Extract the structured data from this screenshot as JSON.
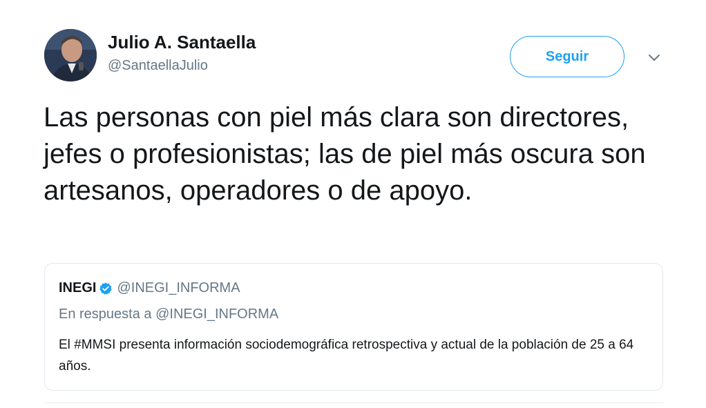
{
  "author": {
    "display_name": "Julio A. Santaella",
    "handle": "@SantaellaJulio",
    "avatar": "avatar-photo"
  },
  "actions": {
    "follow_label": "Seguir",
    "menu_icon": "chevron-down-icon"
  },
  "tweet": {
    "text": "Las personas con piel más clara son directores, jefes o profesionistas; las de piel más oscura son artesanos, operadores o de apoyo."
  },
  "quoted": {
    "name": "INEGI",
    "verified_icon": "verified-badge-icon",
    "handle": "@INEGI_INFORMA",
    "reply_context": "En respuesta a @INEGI_INFORMA",
    "text": "El #MMSI presenta información sociodemográfica retrospectiva y actual de la población de 25 a 64 años."
  },
  "colors": {
    "accent": "#1da1f2",
    "text": "#14171a",
    "secondary_text": "#657786",
    "border": "#e1e8ed"
  }
}
